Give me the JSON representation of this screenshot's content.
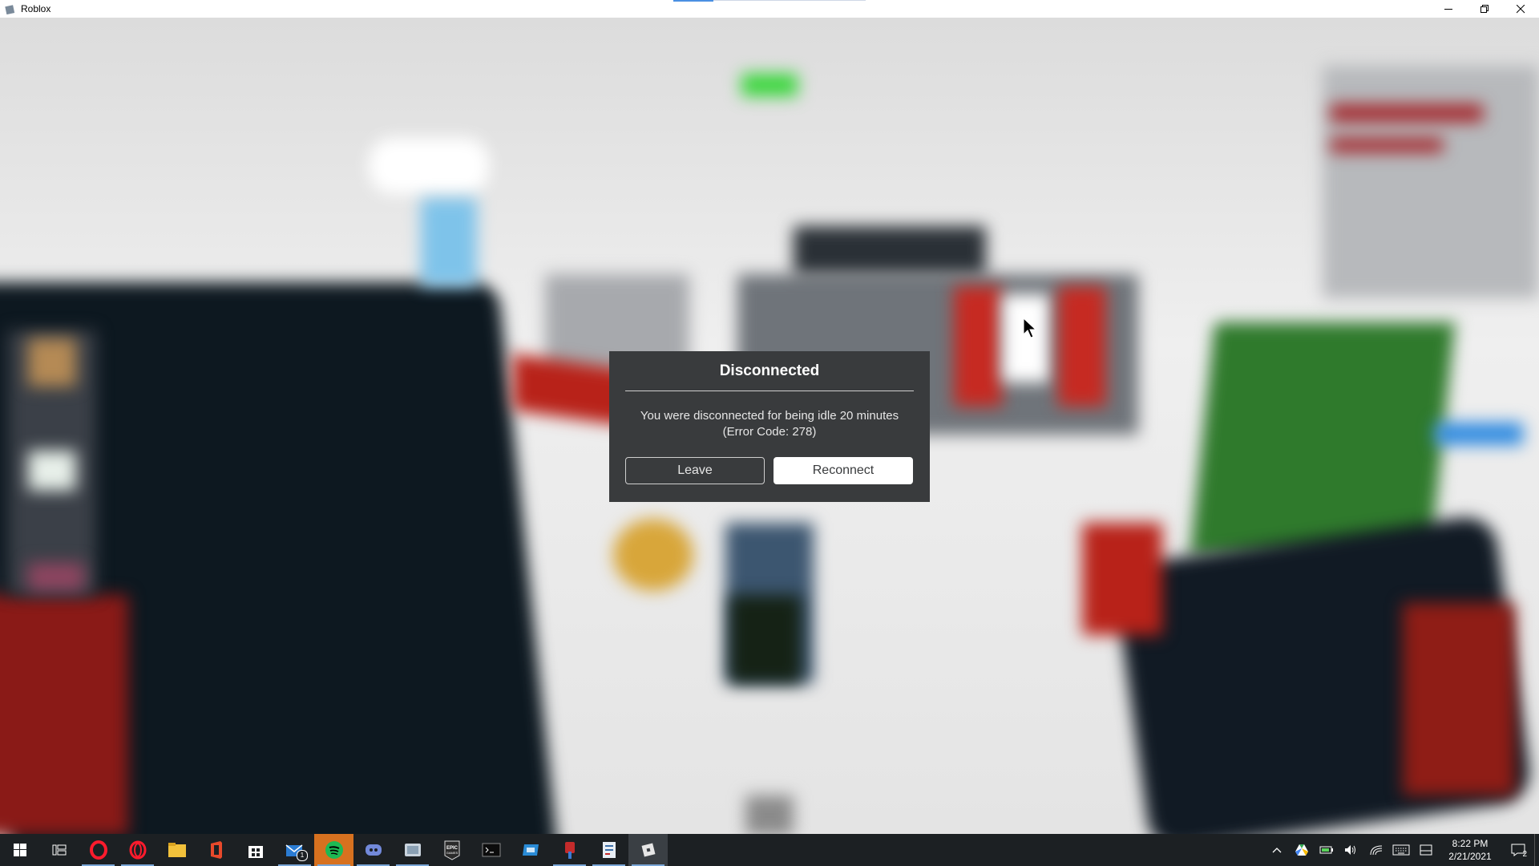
{
  "window": {
    "title": "Roblox",
    "controls": {
      "minimize": "minimize-icon",
      "restore": "restore-icon",
      "close": "close-icon"
    }
  },
  "dialog": {
    "title": "Disconnected",
    "message_line1": "You were disconnected for being idle 20 minutes",
    "message_line2": "(Error Code: 278)",
    "leave_label": "Leave",
    "reconnect_label": "Reconnect"
  },
  "taskbar": {
    "apps": [
      {
        "name": "start-icon"
      },
      {
        "name": "task-view-icon"
      },
      {
        "name": "opera-gx-icon"
      },
      {
        "name": "opera-icon"
      },
      {
        "name": "file-explorer-icon"
      },
      {
        "name": "office-icon"
      },
      {
        "name": "microsoft-store-icon"
      },
      {
        "name": "mail-icon",
        "badge": "1"
      },
      {
        "name": "spotify-icon"
      },
      {
        "name": "discord-icon"
      },
      {
        "name": "app-icon"
      },
      {
        "name": "epic-games-icon",
        "label": "EPIC GAMES"
      },
      {
        "name": "terminal-icon"
      },
      {
        "name": "app-icon-2"
      },
      {
        "name": "app-icon-3"
      },
      {
        "name": "app-icon-4"
      },
      {
        "name": "roblox-icon"
      }
    ],
    "tray_icons": [
      "chevron-up-icon",
      "google-drive-icon",
      "battery-icon",
      "volume-icon",
      "wifi-icon",
      "keyboard-icon",
      "input-icon"
    ],
    "time": "8:22 PM",
    "date": "2/21/2021",
    "notification_count": "2"
  },
  "colors": {
    "dialog_bg": "#393b3d",
    "taskbar_bg": "#1c2023",
    "spotify_green": "#1db954",
    "opera_red": "#ff1b2d"
  }
}
